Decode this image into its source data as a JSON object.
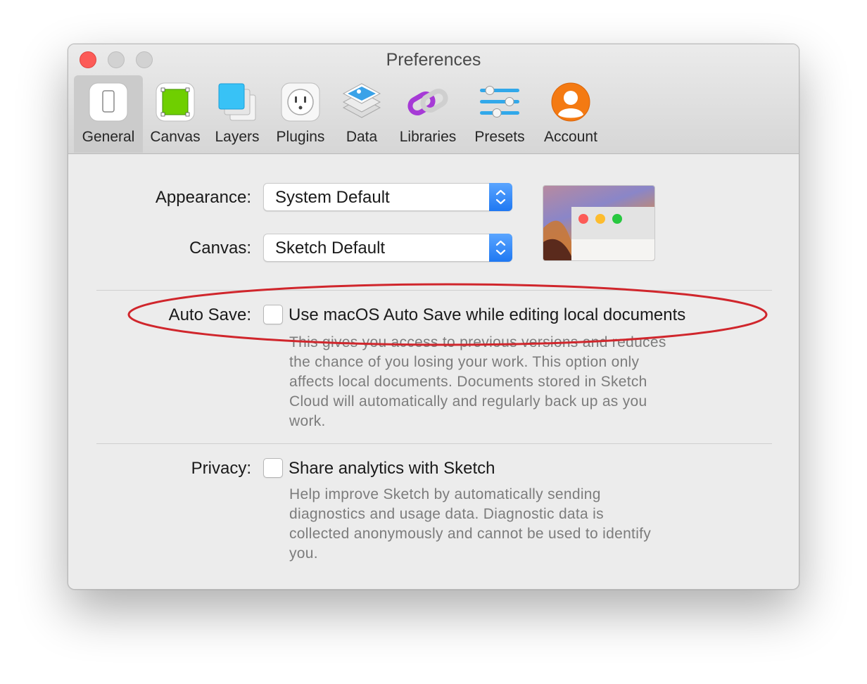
{
  "window": {
    "title": "Preferences"
  },
  "toolbar": {
    "items": [
      {
        "label": "General",
        "icon": "general-icon",
        "selected": true
      },
      {
        "label": "Canvas",
        "icon": "canvas-icon",
        "selected": false
      },
      {
        "label": "Layers",
        "icon": "layers-icon",
        "selected": false
      },
      {
        "label": "Plugins",
        "icon": "plugins-icon",
        "selected": false
      },
      {
        "label": "Data",
        "icon": "data-icon",
        "selected": false
      },
      {
        "label": "Libraries",
        "icon": "libraries-icon",
        "selected": false
      },
      {
        "label": "Presets",
        "icon": "presets-icon",
        "selected": false
      },
      {
        "label": "Account",
        "icon": "account-icon",
        "selected": false
      }
    ]
  },
  "general": {
    "appearance": {
      "label": "Appearance:",
      "value": "System Default"
    },
    "canvas": {
      "label": "Canvas:",
      "value": "Sketch Default"
    },
    "auto_save": {
      "label": "Auto Save:",
      "checkbox_label": "Use macOS Auto Save while editing local documents",
      "checked": false,
      "description_lines": [
        "This gives you access to previous versions and reduces",
        "the chance of you losing your work. This option only",
        "affects local documents. Documents stored in Sketch",
        "Cloud will automatically and regularly back up as you",
        "work."
      ]
    },
    "privacy": {
      "label": "Privacy:",
      "checkbox_label": "Share analytics with Sketch",
      "checked": false,
      "description_lines": [
        "Help improve Sketch by automatically sending",
        "diagnostics and usage data. Diagnostic data is",
        "collected anonymously and cannot be used to identify",
        "you."
      ]
    }
  },
  "colors": {
    "accent": "#1f78f2",
    "annotation": "#d0262c",
    "close": "#fc5b57"
  }
}
